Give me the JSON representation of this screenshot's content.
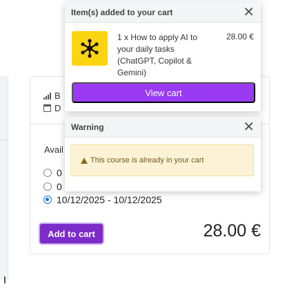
{
  "course": {
    "level_initial": "B",
    "date_initial": "D",
    "availability_label": "Avail",
    "options": [
      {
        "label": "0",
        "selected": false
      },
      {
        "label": "0",
        "selected": false
      },
      {
        "label": "10/12/2025 - 10/12/2025",
        "selected": true
      }
    ],
    "add_to_cart_label": "Add to cart",
    "price": "28.00 €",
    "icons": {
      "level": "signal-bars-icon",
      "date": "calendar-icon"
    }
  },
  "cart_popup": {
    "title": "Item(s) added to your cart",
    "close_icon": "close-icon",
    "item": {
      "description": "1 x How to apply AI to your daily tasks (ChatGPT, Copilot & Gemini)",
      "price": "28.00 €",
      "thumbnail_icon": "network-icon",
      "thumbnail_color": "#FCD512"
    },
    "view_cart_label": "View cart"
  },
  "warning_popup": {
    "title": "Warning",
    "close_icon": "close-icon",
    "message": "This course is already in your cart",
    "icon": "warning-icon"
  },
  "colors": {
    "accent": "#7B2CC9",
    "view_cart": "#9A3AF3",
    "warning_bg": "#FCF3D6"
  }
}
